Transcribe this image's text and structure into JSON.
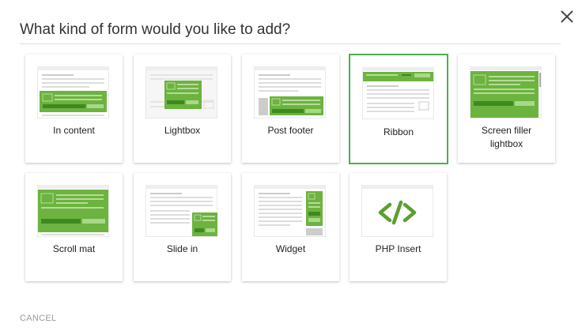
{
  "dialog": {
    "title": "What kind of form would you like to add?",
    "cancel_label": "CANCEL",
    "accent_color": "#4caf50",
    "thumb_green": "#6cb33f"
  },
  "cards": [
    {
      "label": "In content",
      "thumbnail": "in-content",
      "selected": false
    },
    {
      "label": "Lightbox",
      "thumbnail": "lightbox",
      "selected": false
    },
    {
      "label": "Post footer",
      "thumbnail": "post-footer",
      "selected": false
    },
    {
      "label": "Ribbon",
      "thumbnail": "ribbon",
      "selected": true
    },
    {
      "label": "Screen filler lightbox",
      "thumbnail": "screen-filler",
      "selected": false
    },
    {
      "label": "Scroll mat",
      "thumbnail": "scroll-mat",
      "selected": false
    },
    {
      "label": "Slide in",
      "thumbnail": "slide-in",
      "selected": false
    },
    {
      "label": "Widget",
      "thumbnail": "widget",
      "selected": false
    },
    {
      "label": "PHP Insert",
      "thumbnail": "php-code",
      "selected": false
    }
  ]
}
